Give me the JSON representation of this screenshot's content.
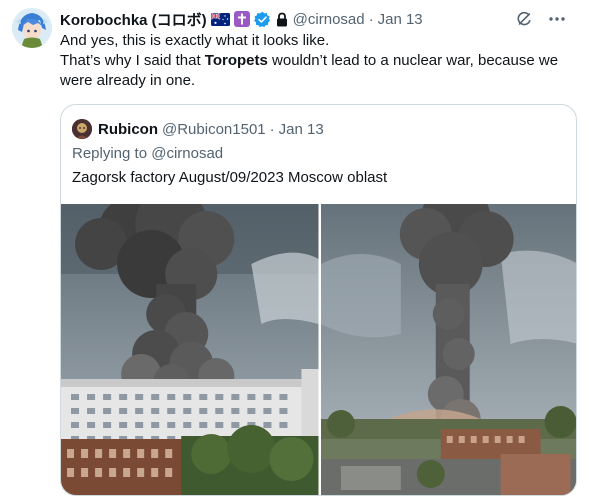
{
  "tweet": {
    "author": {
      "display_name": "Korobochka (コロボ)",
      "handle": "@cirnosad",
      "badges": [
        "australia-flag",
        "latin-cross-emoji",
        "verified-badge",
        "lock"
      ]
    },
    "separator": "·",
    "timestamp": "Jan 13",
    "text_line1": "And yes, this is exactly what it looks like.",
    "text_line2_before": "That’s why I said that ",
    "text_line2_bold": "Toropets",
    "text_line2_after": " wouldn’t lead to a nuclear war, because we",
    "text_line3": "were already in one.",
    "actions": [
      "grok-icon",
      "more-icon"
    ]
  },
  "quote": {
    "author": {
      "display_name": "Rubicon",
      "handle": "@Rubicon1501"
    },
    "separator": "·",
    "timestamp": "Jan 13",
    "replying_to": "Replying to @cirnosad",
    "text": "Zagorsk factory August/09/2023 Moscow oblast",
    "media": [
      "explosion-photo-left",
      "explosion-photo-right"
    ]
  },
  "colors": {
    "text": "#0f1419",
    "secondary": "#536471",
    "border": "#cfd9de",
    "verified": "#1d9bf0"
  }
}
